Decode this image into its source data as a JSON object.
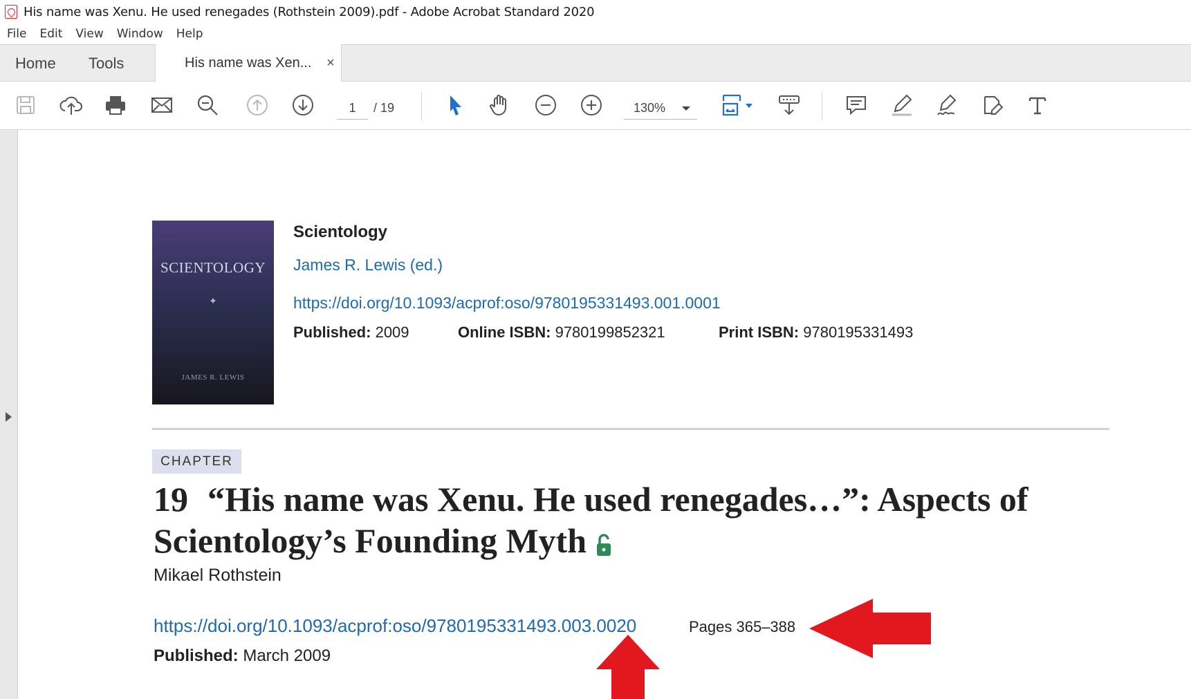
{
  "window": {
    "title": "His name was Xenu. He used renegades (Rothstein 2009).pdf - Adobe Acrobat Standard 2020"
  },
  "menu": {
    "items": [
      "File",
      "Edit",
      "View",
      "Window",
      "Help"
    ]
  },
  "tabs": {
    "home": "Home",
    "tools": "Tools",
    "document": "His name was Xen...",
    "close": "×"
  },
  "toolbar": {
    "page_current": "1",
    "page_total": "/  19",
    "zoom": "130%",
    "icons": [
      "save-icon",
      "upload-cloud-icon",
      "print-icon",
      "email-icon",
      "find-zoom-icon",
      "page-up-icon",
      "page-down-icon",
      "select-cursor-icon",
      "hand-icon",
      "zoom-out-icon",
      "zoom-in-icon",
      "page-fit-icon",
      "read-mode-icon",
      "comment-icon",
      "highlight-icon",
      "sign-icon",
      "edit-pdf-icon",
      "text-icon"
    ],
    "accent_color": "#1f6fd1"
  },
  "book": {
    "cover_title": "SCIENTOLOGY",
    "cover_author": "JAMES R. LEWIS",
    "title": "Scientology",
    "editor": "James R. Lewis (ed.)",
    "doi": "https://doi.org/10.1093/acprof:oso/9780195331493.001.0001",
    "published_label": "Published:",
    "published_value": "2009",
    "online_isbn_label": "Online ISBN:",
    "online_isbn_value": "9780199852321",
    "print_isbn_label": "Print ISBN:",
    "print_isbn_value": "9780195331493"
  },
  "chapter": {
    "badge": "CHAPTER",
    "number": "19",
    "title_line1": "“His name was Xenu. He used renegades…”: Aspects of",
    "title_line2": "Scientology’s Founding Myth",
    "author": "Mikael Rothstein",
    "doi": "https://doi.org/10.1093/acprof:oso/9780195331493.003.0020",
    "pages": "Pages 365–388",
    "published_label": "Published:",
    "published_value": "March 2009"
  },
  "colors": {
    "link": "#1f6aad",
    "arrow": "#e3181f",
    "lock": "#2e8b57"
  }
}
